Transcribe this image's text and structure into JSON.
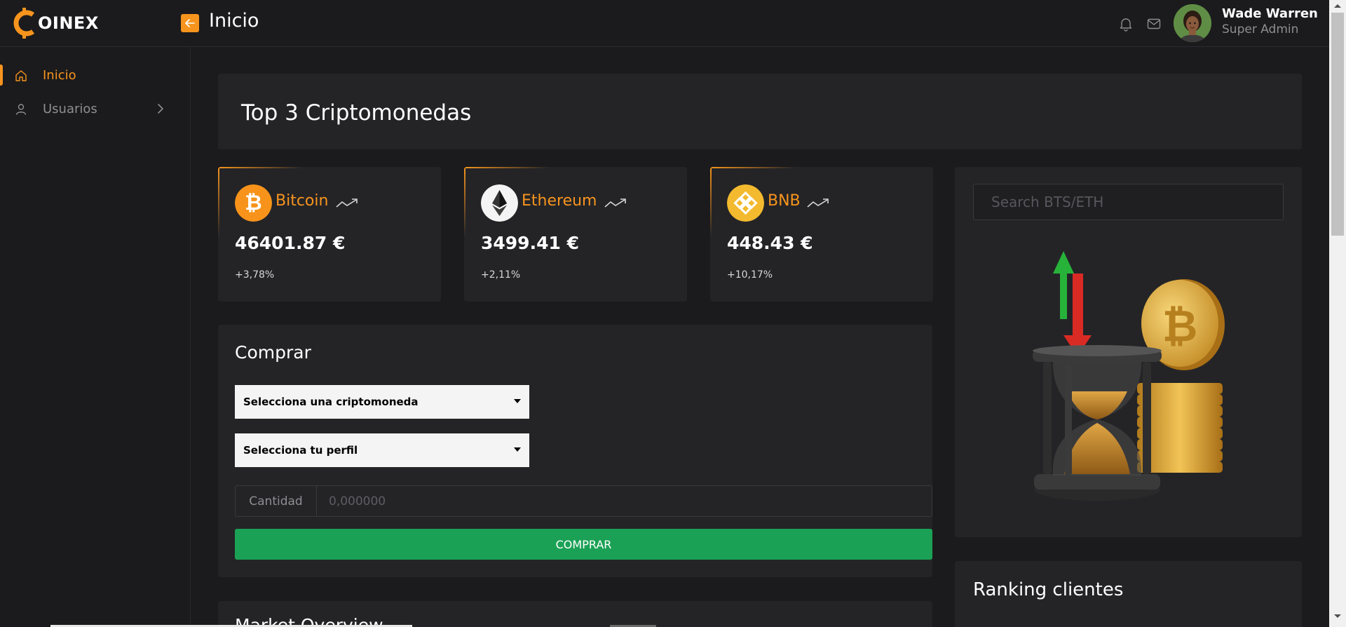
{
  "app": {
    "logo_text": "OINEX"
  },
  "header": {
    "title": "Inicio",
    "back_icon": "arrow-left-icon",
    "bell_icon": "bell-icon",
    "mail_icon": "mail-icon"
  },
  "user": {
    "name": "Wade Warren",
    "role": "Super Admin"
  },
  "sidebar": {
    "items": [
      {
        "label": "Inicio",
        "icon": "home-icon",
        "active": true
      },
      {
        "label": "Usuarios",
        "icon": "user-icon",
        "active": false
      }
    ]
  },
  "main": {
    "banner_title": "Top 3 Criptomonedas",
    "coins": [
      {
        "name": "Bitcoin",
        "price": "46401.87 €",
        "change": "+3,78%",
        "color": "#f7931a"
      },
      {
        "name": "Ethereum",
        "price": "3499.41 €",
        "change": "+2,11%",
        "color": "#f4f4f4"
      },
      {
        "name": "BNB",
        "price": "448.43 €",
        "change": "+10,17%",
        "color": "#f3ba2f"
      }
    ],
    "buy": {
      "title": "Comprar",
      "select_crypto": "Selecciona una criptomoneda",
      "select_profile": "Selecciona tu perfil",
      "qty_label": "Cantidad",
      "qty_placeholder": "0,000000",
      "button": "COMPRAR"
    },
    "market_title": "Market Overview",
    "search_placeholder": "Search BTS/ETH",
    "ranking_title": "Ranking clientes"
  },
  "colors": {
    "accent": "#f7941d",
    "buy_green": "#1ba155",
    "background": "#1b1b1d",
    "panel": "#242427"
  }
}
